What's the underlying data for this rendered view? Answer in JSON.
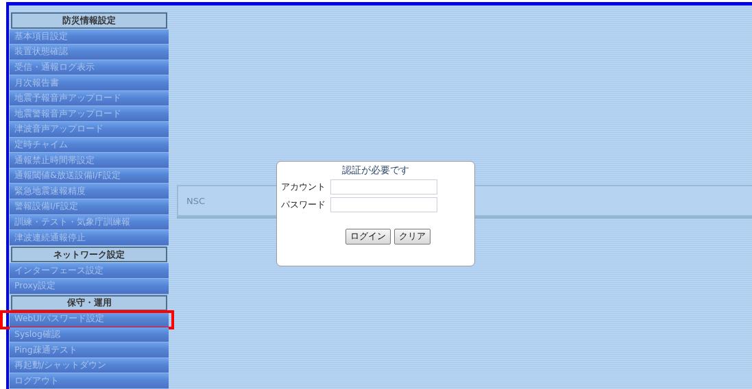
{
  "sidebar": {
    "sections": [
      {
        "title": "防災情報設定",
        "items": [
          {
            "label": "基本項目設定",
            "highlighted": false
          },
          {
            "label": "装置状態確認",
            "highlighted": false
          },
          {
            "label": "受信・通報ログ表示",
            "highlighted": false
          },
          {
            "label": "月次報告書",
            "highlighted": false
          },
          {
            "label": "地震予報音声アップロード",
            "highlighted": false
          },
          {
            "label": "地震警報音声アップロード",
            "highlighted": false
          },
          {
            "label": "津波音声アップロード",
            "highlighted": false
          },
          {
            "label": "定時チャイム",
            "highlighted": false
          },
          {
            "label": "通報禁止時間帯設定",
            "highlighted": false
          },
          {
            "label": "通報閾値&放送設備I/F設定",
            "highlighted": false
          },
          {
            "label": "緊急地震速報精度",
            "highlighted": false
          },
          {
            "label": "警報設備I/F設定",
            "highlighted": false
          },
          {
            "label": "訓練・テスト・気象庁訓練報",
            "highlighted": false
          },
          {
            "label": "津波連続通報停止",
            "highlighted": false
          }
        ]
      },
      {
        "title": "ネットワーク設定",
        "items": [
          {
            "label": "インターフェース設定",
            "highlighted": false
          },
          {
            "label": "Proxy設定",
            "highlighted": false
          }
        ]
      },
      {
        "title": "保守・運用",
        "items": [
          {
            "label": "WebUIパスワード設定",
            "highlighted": true
          },
          {
            "label": "Syslog確認",
            "highlighted": false
          },
          {
            "label": "Ping疎通テスト",
            "highlighted": false
          },
          {
            "label": "再起動/シャットダウン",
            "highlighted": false
          },
          {
            "label": "ログアウト",
            "highlighted": false
          }
        ]
      }
    ]
  },
  "panel": {
    "text": "NSC"
  },
  "dialog": {
    "title": "認証が必要です",
    "fields": [
      {
        "label": "アカウント"
      },
      {
        "label": "パスワード"
      }
    ],
    "buttons": [
      "ログイン",
      "クリア"
    ]
  }
}
